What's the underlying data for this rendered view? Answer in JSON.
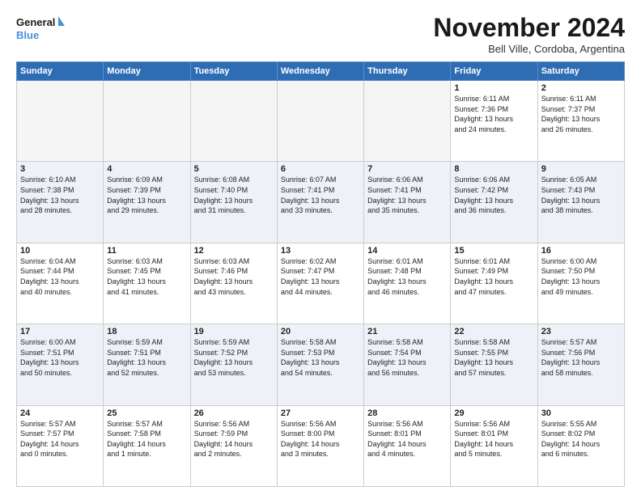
{
  "logo": {
    "line1": "General",
    "line2": "Blue"
  },
  "header": {
    "month": "November 2024",
    "location": "Bell Ville, Cordoba, Argentina"
  },
  "weekdays": [
    "Sunday",
    "Monday",
    "Tuesday",
    "Wednesday",
    "Thursday",
    "Friday",
    "Saturday"
  ],
  "weeks": [
    [
      {
        "day": "",
        "info": ""
      },
      {
        "day": "",
        "info": ""
      },
      {
        "day": "",
        "info": ""
      },
      {
        "day": "",
        "info": ""
      },
      {
        "day": "",
        "info": ""
      },
      {
        "day": "1",
        "info": "Sunrise: 6:11 AM\nSunset: 7:36 PM\nDaylight: 13 hours\nand 24 minutes."
      },
      {
        "day": "2",
        "info": "Sunrise: 6:11 AM\nSunset: 7:37 PM\nDaylight: 13 hours\nand 26 minutes."
      }
    ],
    [
      {
        "day": "3",
        "info": "Sunrise: 6:10 AM\nSunset: 7:38 PM\nDaylight: 13 hours\nand 28 minutes."
      },
      {
        "day": "4",
        "info": "Sunrise: 6:09 AM\nSunset: 7:39 PM\nDaylight: 13 hours\nand 29 minutes."
      },
      {
        "day": "5",
        "info": "Sunrise: 6:08 AM\nSunset: 7:40 PM\nDaylight: 13 hours\nand 31 minutes."
      },
      {
        "day": "6",
        "info": "Sunrise: 6:07 AM\nSunset: 7:41 PM\nDaylight: 13 hours\nand 33 minutes."
      },
      {
        "day": "7",
        "info": "Sunrise: 6:06 AM\nSunset: 7:41 PM\nDaylight: 13 hours\nand 35 minutes."
      },
      {
        "day": "8",
        "info": "Sunrise: 6:06 AM\nSunset: 7:42 PM\nDaylight: 13 hours\nand 36 minutes."
      },
      {
        "day": "9",
        "info": "Sunrise: 6:05 AM\nSunset: 7:43 PM\nDaylight: 13 hours\nand 38 minutes."
      }
    ],
    [
      {
        "day": "10",
        "info": "Sunrise: 6:04 AM\nSunset: 7:44 PM\nDaylight: 13 hours\nand 40 minutes."
      },
      {
        "day": "11",
        "info": "Sunrise: 6:03 AM\nSunset: 7:45 PM\nDaylight: 13 hours\nand 41 minutes."
      },
      {
        "day": "12",
        "info": "Sunrise: 6:03 AM\nSunset: 7:46 PM\nDaylight: 13 hours\nand 43 minutes."
      },
      {
        "day": "13",
        "info": "Sunrise: 6:02 AM\nSunset: 7:47 PM\nDaylight: 13 hours\nand 44 minutes."
      },
      {
        "day": "14",
        "info": "Sunrise: 6:01 AM\nSunset: 7:48 PM\nDaylight: 13 hours\nand 46 minutes."
      },
      {
        "day": "15",
        "info": "Sunrise: 6:01 AM\nSunset: 7:49 PM\nDaylight: 13 hours\nand 47 minutes."
      },
      {
        "day": "16",
        "info": "Sunrise: 6:00 AM\nSunset: 7:50 PM\nDaylight: 13 hours\nand 49 minutes."
      }
    ],
    [
      {
        "day": "17",
        "info": "Sunrise: 6:00 AM\nSunset: 7:51 PM\nDaylight: 13 hours\nand 50 minutes."
      },
      {
        "day": "18",
        "info": "Sunrise: 5:59 AM\nSunset: 7:51 PM\nDaylight: 13 hours\nand 52 minutes."
      },
      {
        "day": "19",
        "info": "Sunrise: 5:59 AM\nSunset: 7:52 PM\nDaylight: 13 hours\nand 53 minutes."
      },
      {
        "day": "20",
        "info": "Sunrise: 5:58 AM\nSunset: 7:53 PM\nDaylight: 13 hours\nand 54 minutes."
      },
      {
        "day": "21",
        "info": "Sunrise: 5:58 AM\nSunset: 7:54 PM\nDaylight: 13 hours\nand 56 minutes."
      },
      {
        "day": "22",
        "info": "Sunrise: 5:58 AM\nSunset: 7:55 PM\nDaylight: 13 hours\nand 57 minutes."
      },
      {
        "day": "23",
        "info": "Sunrise: 5:57 AM\nSunset: 7:56 PM\nDaylight: 13 hours\nand 58 minutes."
      }
    ],
    [
      {
        "day": "24",
        "info": "Sunrise: 5:57 AM\nSunset: 7:57 PM\nDaylight: 14 hours\nand 0 minutes."
      },
      {
        "day": "25",
        "info": "Sunrise: 5:57 AM\nSunset: 7:58 PM\nDaylight: 14 hours\nand 1 minute."
      },
      {
        "day": "26",
        "info": "Sunrise: 5:56 AM\nSunset: 7:59 PM\nDaylight: 14 hours\nand 2 minutes."
      },
      {
        "day": "27",
        "info": "Sunrise: 5:56 AM\nSunset: 8:00 PM\nDaylight: 14 hours\nand 3 minutes."
      },
      {
        "day": "28",
        "info": "Sunrise: 5:56 AM\nSunset: 8:01 PM\nDaylight: 14 hours\nand 4 minutes."
      },
      {
        "day": "29",
        "info": "Sunrise: 5:56 AM\nSunset: 8:01 PM\nDaylight: 14 hours\nand 5 minutes."
      },
      {
        "day": "30",
        "info": "Sunrise: 5:55 AM\nSunset: 8:02 PM\nDaylight: 14 hours\nand 6 minutes."
      }
    ]
  ]
}
